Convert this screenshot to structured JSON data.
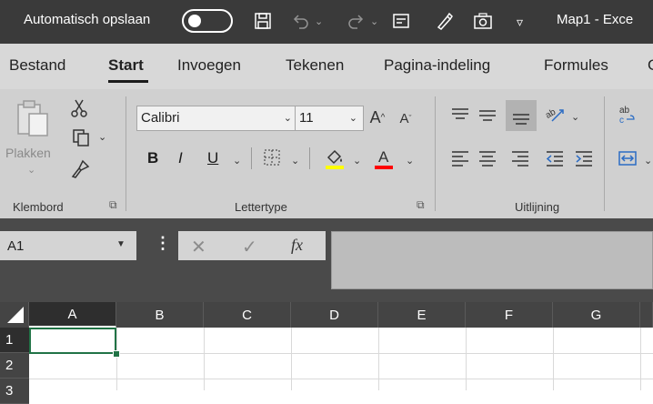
{
  "titlebar": {
    "autosave_label": "Automatisch opslaan",
    "autosave_state": "off",
    "workbook_title": "Map1  -  Exce"
  },
  "tabs": [
    {
      "label": "Bestand"
    },
    {
      "label": "Start",
      "active": true
    },
    {
      "label": "Invoegen"
    },
    {
      "label": "Tekenen"
    },
    {
      "label": "Pagina-indeling"
    },
    {
      "label": "Formules"
    },
    {
      "label": "G"
    }
  ],
  "ribbon": {
    "clipboard": {
      "paste_label": "Plakken",
      "group_label": "Klembord"
    },
    "font": {
      "font_name": "Calibri",
      "font_size": "11",
      "bold": "B",
      "italic": "I",
      "underline": "U",
      "group_label": "Lettertype"
    },
    "alignment": {
      "group_label": "Uitlijning"
    },
    "colors": {
      "highlight": "#ffff00",
      "font_color": "#ff0000"
    }
  },
  "formulabar": {
    "namebox_value": "A1",
    "fx_label": "fx",
    "formula_value": ""
  },
  "grid": {
    "columns": [
      "A",
      "B",
      "C",
      "D",
      "E",
      "F",
      "G"
    ],
    "rows": [
      "1",
      "2",
      "3"
    ],
    "selected_cell": "A1"
  }
}
